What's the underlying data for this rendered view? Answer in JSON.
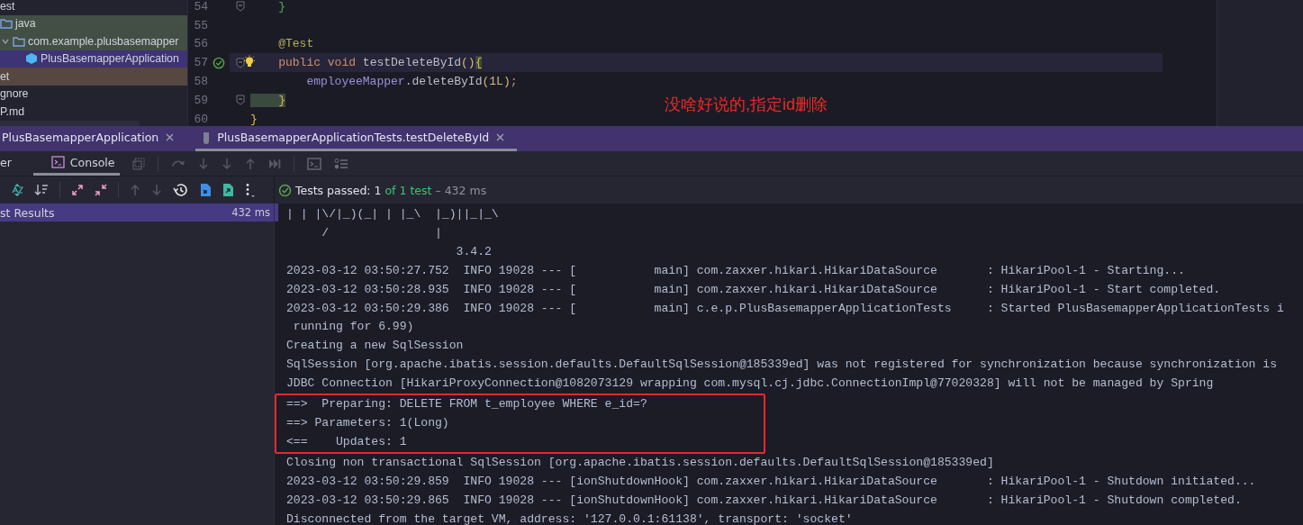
{
  "project_tree": {
    "items": [
      {
        "label": "est",
        "selected": false,
        "children": [
          {
            "label": "java",
            "kind": "folder",
            "selected": false,
            "color": "#434f45",
            "children": [
              {
                "label": "com.example.plusbasemapper",
                "kind": "package",
                "selected": false,
                "expanded": true,
                "color": "#434f45",
                "children": [
                  {
                    "label": "PlusBasemapperApplication",
                    "kind": "class",
                    "selected": true
                  }
                ]
              }
            ]
          }
        ]
      },
      {
        "label": "et",
        "selected": false,
        "color": "#574741"
      },
      {
        "label": "gnore",
        "selected": false
      },
      {
        "label": "P.md",
        "selected": false
      }
    ]
  },
  "editor": {
    "lines": [
      {
        "number": "54",
        "current": false,
        "fold": true,
        "passed": false,
        "tokens": [
          {
            "text": "    }",
            "kind": "green-brace"
          }
        ]
      },
      {
        "number": "55",
        "current": false,
        "fold": false,
        "passed": false
      },
      {
        "number": "56",
        "current": false,
        "fold": false,
        "passed": false,
        "tokens": [
          {
            "text": "    @Test",
            "kind": "annotation"
          }
        ]
      },
      {
        "number": "57",
        "current": true,
        "fold": true,
        "passed": true,
        "tokens": [
          {
            "text": "    public void ",
            "kind": "keyword"
          },
          {
            "text": "testDeleteById",
            "kind": "plain"
          },
          {
            "text": "()",
            "kind": "paren"
          },
          {
            "text": "{",
            "kind": "matched-brace"
          }
        ]
      },
      {
        "number": "58",
        "current": false,
        "fold": false,
        "passed": false,
        "tokens": [
          {
            "text": "        employeeMapper",
            "kind": "field"
          },
          {
            "text": ".deleteById",
            "kind": "plain"
          },
          {
            "text": "(",
            "kind": "paren"
          },
          {
            "text": "1L",
            "kind": "number"
          },
          {
            "text": ")",
            "kind": "paren"
          },
          {
            "text": ";",
            "kind": "keyword"
          }
        ]
      },
      {
        "number": "59",
        "current": false,
        "fold": true,
        "passed": false,
        "tokens": [
          {
            "text": "    }",
            "kind": "matched-brace"
          }
        ]
      },
      {
        "number": "60",
        "current": false,
        "fold": false,
        "passed": false,
        "tokens": [
          {
            "text": "}",
            "kind": "brace"
          }
        ]
      }
    ]
  },
  "annotation": "没啥好说的,指定id删除",
  "run_tabs": [
    {
      "label": "PlusBasemapperApplication",
      "kind": "app",
      "selected": false
    },
    {
      "label": "PlusBasemapperApplicationTests.testDeleteById",
      "kind": "test",
      "selected": true
    }
  ],
  "tool_tabs": [
    {
      "label": "er",
      "kind": "plain",
      "selected": false
    },
    {
      "label": "Console",
      "kind": "console",
      "selected": true
    }
  ],
  "test_status": {
    "label": "Tests passed: 1",
    "count": "of 1 test",
    "duration": "– 432 ms"
  },
  "test_tree": {
    "items": [
      {
        "label": "st Results",
        "duration": "432 ms",
        "selected": true
      }
    ]
  },
  "console": {
    "lines": [
      {
        "text": "| | |\\/|_)(_| | |_\\  |_)||_|_\\",
        "boxed": false
      },
      {
        "text": "     /               |",
        "boxed": false
      },
      {
        "text": "                        3.4.2",
        "boxed": false
      },
      {
        "text": "2023-03-12 03:50:27.752  INFO 19028 --- [           main] com.zaxxer.hikari.HikariDataSource       : HikariPool-1 - Starting...",
        "boxed": false
      },
      {
        "text": "2023-03-12 03:50:28.935  INFO 19028 --- [           main] com.zaxxer.hikari.HikariDataSource       : HikariPool-1 - Start completed.",
        "boxed": false
      },
      {
        "text": "2023-03-12 03:50:29.386  INFO 19028 --- [           main] c.e.p.PlusBasemapperApplicationTests     : Started PlusBasemapperApplicationTests i",
        "boxed": false
      },
      {
        "text": " running for 6.99)",
        "boxed": false
      },
      {
        "text": "Creating a new SqlSession",
        "boxed": false
      },
      {
        "text": "SqlSession [org.apache.ibatis.session.defaults.DefaultSqlSession@185339ed] was not registered for synchronization because synchronization is",
        "boxed": false
      },
      {
        "text": "JDBC Connection [HikariProxyConnection@1082073129 wrapping com.mysql.cj.jdbc.ConnectionImpl@77020328] will not be managed by Spring",
        "boxed": false
      },
      {
        "text": "==>  Preparing: DELETE FROM t_employee WHERE e_id=?",
        "boxed": true
      },
      {
        "text": "==> Parameters: 1(Long)",
        "boxed": true
      },
      {
        "text": "<==    Updates: 1",
        "boxed": true
      },
      {
        "text": "Closing non transactional SqlSession [org.apache.ibatis.session.defaults.DefaultSqlSession@185339ed]",
        "boxed": false
      },
      {
        "text": "2023-03-12 03:50:29.859  INFO 19028 --- [ionShutdownHook] com.zaxxer.hikari.HikariDataSource       : HikariPool-1 - Shutdown initiated...",
        "boxed": false
      },
      {
        "text": "2023-03-12 03:50:29.865  INFO 19028 --- [ionShutdownHook] com.zaxxer.hikari.HikariDataSource       : HikariPool-1 - Shutdown completed.",
        "boxed": false
      },
      {
        "text": "Disconnected from the target VM, address: '127.0.0.1:61138', transport: 'socket'",
        "boxed": false
      }
    ]
  }
}
